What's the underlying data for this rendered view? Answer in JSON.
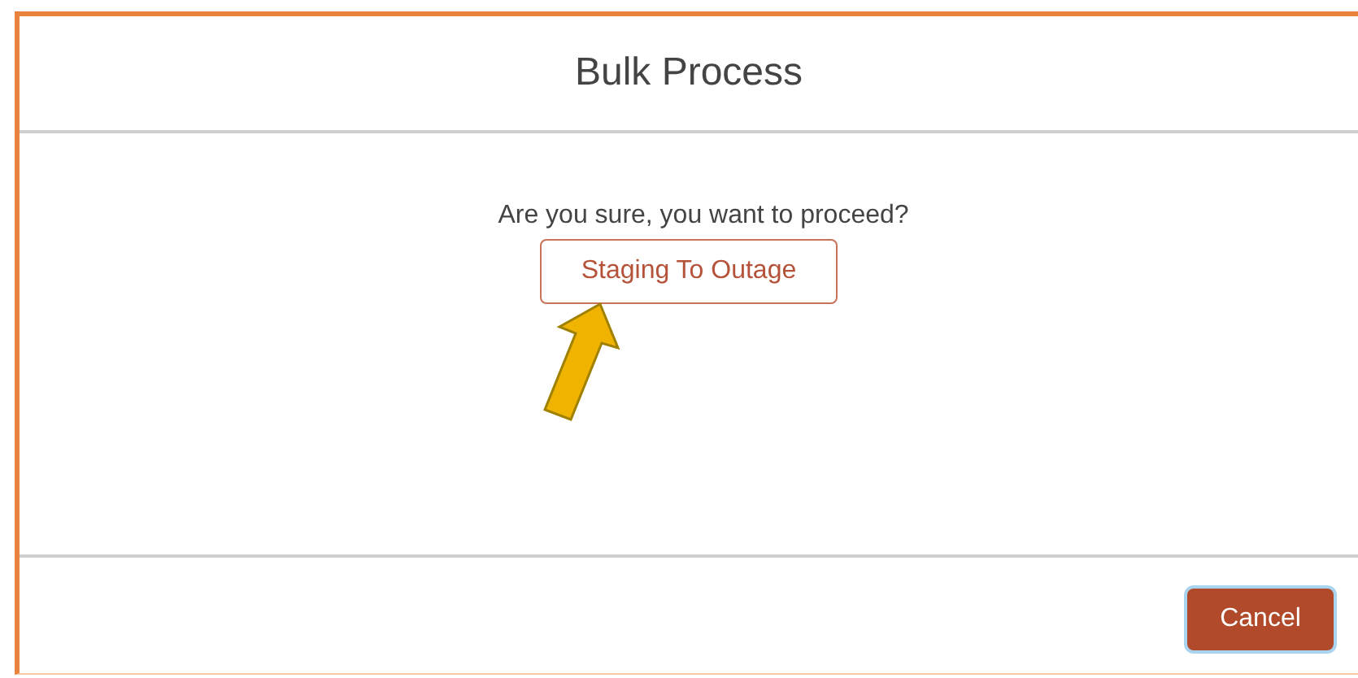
{
  "dialog": {
    "title": "Bulk Process",
    "message": "Are you sure, you want to proceed?",
    "action_button": "Staging To Outage",
    "annotation": {
      "kind": "arrow"
    },
    "footer_buttons": [
      {
        "label": "Cancel",
        "focused": true
      }
    ]
  }
}
